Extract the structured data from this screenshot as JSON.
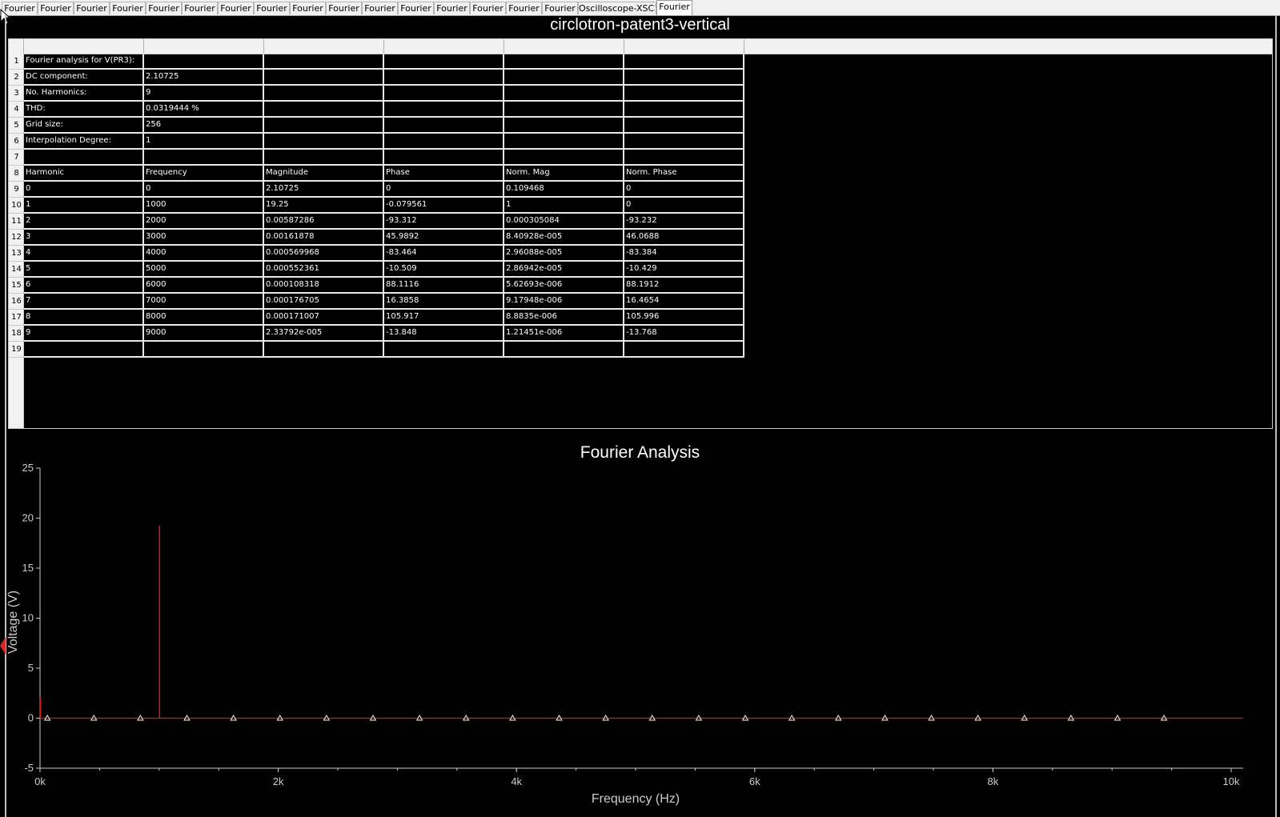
{
  "tabs": [
    {
      "label": "Fourier"
    },
    {
      "label": "Fourier"
    },
    {
      "label": "Fourier"
    },
    {
      "label": "Fourier"
    },
    {
      "label": "Fourier"
    },
    {
      "label": "Fourier"
    },
    {
      "label": "Fourier"
    },
    {
      "label": "Fourier"
    },
    {
      "label": "Fourier"
    },
    {
      "label": "Fourier"
    },
    {
      "label": "Fourier"
    },
    {
      "label": "Fourier"
    },
    {
      "label": "Fourier"
    },
    {
      "label": "Fourier"
    },
    {
      "label": "Fourier"
    },
    {
      "label": "Fourier"
    },
    {
      "label": "Oscilloscope-XSC1"
    },
    {
      "label": "Fourier",
      "active": true
    }
  ],
  "sheet_title": "circlotron-patent3-vertical",
  "table": {
    "row_numbers": [
      "1",
      "2",
      "3",
      "4",
      "5",
      "6",
      "7",
      "8",
      "9",
      "10",
      "11",
      "12",
      "13",
      "14",
      "15",
      "16",
      "17",
      "18",
      "19"
    ],
    "rows": [
      [
        "Fourier analysis for V(PR3):",
        "",
        "",
        "",
        "",
        ""
      ],
      [
        "DC component:",
        "2.10725",
        "",
        "",
        "",
        ""
      ],
      [
        "No. Harmonics:",
        "9",
        "",
        "",
        "",
        ""
      ],
      [
        "THD:",
        "0.0319444 %",
        "",
        "",
        "",
        ""
      ],
      [
        "Grid size:",
        "256",
        "",
        "",
        "",
        ""
      ],
      [
        "Interpolation Degree:",
        "1",
        "",
        "",
        "",
        ""
      ],
      [
        "",
        "",
        "",
        "",
        "",
        ""
      ],
      [
        "Harmonic",
        "Frequency",
        "Magnitude",
        "Phase",
        "Norm. Mag",
        "Norm. Phase"
      ],
      [
        "0",
        "0",
        "2.10725",
        "0",
        "0.109468",
        "0"
      ],
      [
        "1",
        "1000",
        "19.25",
        "-0.079561",
        "1",
        "0"
      ],
      [
        "2",
        "2000",
        "0.00587286",
        "-93.312",
        "0.000305084",
        "-93.232"
      ],
      [
        "3",
        "3000",
        "0.00161878",
        "45.9892",
        "8.40928e-005",
        "46.0688"
      ],
      [
        "4",
        "4000",
        "0.000569968",
        "-83.464",
        "2.96088e-005",
        "-83.384"
      ],
      [
        "5",
        "5000",
        "0.000552361",
        "-10.509",
        "2.86942e-005",
        "-10.429"
      ],
      [
        "6",
        "6000",
        "0.000108318",
        "88.1116",
        "5.62693e-006",
        "88.1912"
      ],
      [
        "7",
        "7000",
        "0.000176705",
        "16.3858",
        "9.17948e-006",
        "16.4654"
      ],
      [
        "8",
        "8000",
        "0.000171007",
        "105.917",
        "8.8835e-006",
        "105.996"
      ],
      [
        "9",
        "9000",
        "2.33792e-005",
        "-13.848",
        "1.21451e-006",
        "-13.768"
      ],
      [
        "",
        "",
        "",
        "",
        "",
        ""
      ]
    ]
  },
  "chart_data": {
    "type": "bar",
    "title": "Fourier Analysis",
    "xlabel": "Frequency (Hz)",
    "ylabel": "Voltage (V)",
    "xlim": [
      0,
      10000
    ],
    "ylim": [
      -5,
      25
    ],
    "x_ticks": [
      0,
      2000,
      4000,
      6000,
      8000,
      10000
    ],
    "x_tick_labels": [
      "0k",
      "2k",
      "4k",
      "6k",
      "8k",
      "10k"
    ],
    "y_ticks": [
      -5,
      0,
      5,
      10,
      15,
      20,
      25
    ],
    "y_tick_labels": [
      "-5",
      "0",
      "5",
      "10",
      "15",
      "20",
      "25"
    ],
    "series": [
      {
        "x": [
          0,
          1000,
          2000,
          3000,
          4000,
          5000,
          6000,
          7000,
          8000,
          9000
        ],
        "values": [
          2.10725,
          19.25,
          0.00587286,
          0.00161878,
          0.000569968,
          0.000552361,
          0.000108318,
          0.000176705,
          0.000171007,
          2.33792e-05
        ]
      }
    ],
    "marker_spacing_hz": 390.625,
    "grid": false,
    "colors": {
      "series": "#cc1f1f",
      "axis": "#cccccc",
      "markers": "#ffffff"
    }
  }
}
